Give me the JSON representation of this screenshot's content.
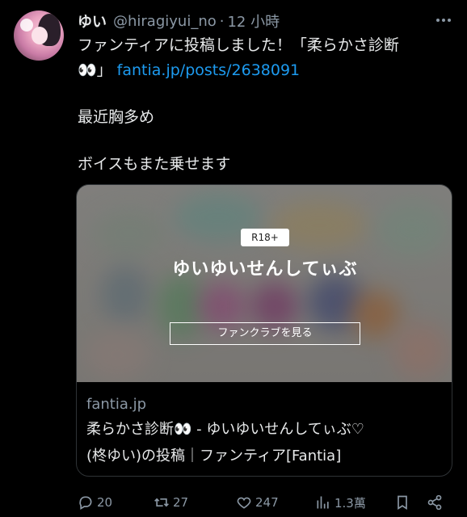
{
  "tweet": {
    "author_name": "ゆい",
    "author_handle": "@hiragiyui_no",
    "separator": "·",
    "time_ago": "12 小時",
    "text_line1": "ファンティアに投稿しました！「柔らかさ診断",
    "text_line2_emoji": "👀」",
    "text_link": "fantia.jp/posts/2638091",
    "text_line3": "最近胸多め",
    "text_line4": "ボイスもまた乗せます"
  },
  "card": {
    "badge": "R18+",
    "title": "ゆいゆいせんしてぃぶ",
    "button_label": "ファンクラブを見る",
    "domain": "fantia.jp",
    "description_line1": "柔らかさ診断👀 - ゆいゆいせんしてぃぶ♡",
    "description_line2": "(柊ゆい)の投稿｜ファンティア[Fantia]"
  },
  "actions": {
    "replies": "20",
    "retweets": "27",
    "likes": "247",
    "views": "1.3萬"
  },
  "icons": {
    "more": "more-icon",
    "reply": "reply-icon",
    "retweet": "retweet-icon",
    "like": "heart-icon",
    "views": "views-icon",
    "bookmark": "bookmark-icon",
    "share": "share-icon"
  },
  "colors": {
    "background": "#000000",
    "text": "#e7e9ea",
    "muted": "#8b98a5",
    "link": "#1d9bf0"
  }
}
